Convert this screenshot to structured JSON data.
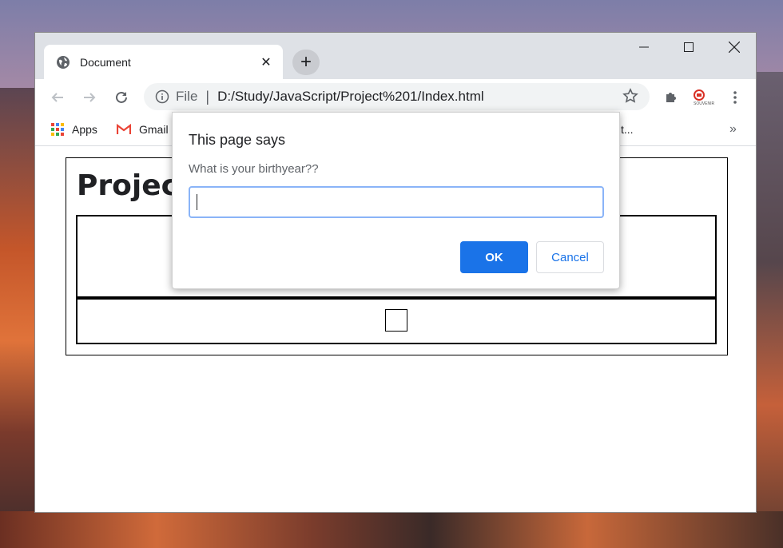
{
  "browser": {
    "tab": {
      "title": "Document",
      "close": "✕"
    },
    "new_tab": "+",
    "window_controls": {
      "minimize": "—",
      "maximize": "☐",
      "close": "✕"
    },
    "omnibox": {
      "scheme": "File",
      "separator": "|",
      "url": "D:/Study/JavaScript/Project%201/Index.html"
    },
    "bookmarks": [
      {
        "label": "Apps",
        "icon": "apps-grid-icon"
      },
      {
        "label": "Gmail",
        "icon": "gmail-icon"
      }
    ],
    "bookmarks_partial": "t...",
    "bookmarks_more": "»",
    "extension_label": "SOUVENIR"
  },
  "page": {
    "title": "Project"
  },
  "dialog": {
    "title": "This page says",
    "message": "What is your birthyear??",
    "input_value": "",
    "ok_label": "OK",
    "cancel_label": "Cancel"
  },
  "colors": {
    "accent": "#1a73e8",
    "titlebar": "#dee1e6",
    "omnibox": "#f1f3f4"
  }
}
